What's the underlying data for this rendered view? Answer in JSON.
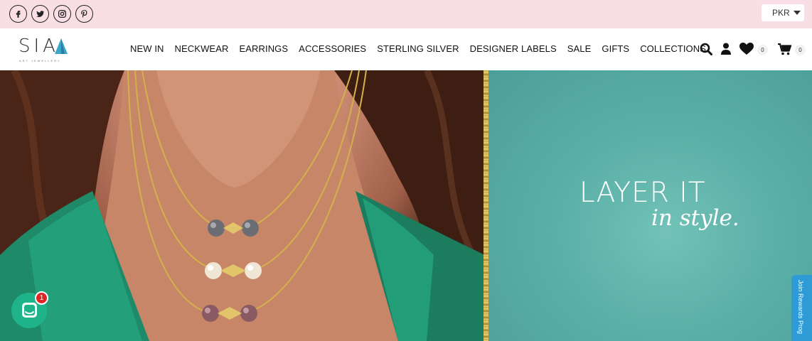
{
  "topbar": {
    "social": [
      {
        "icon": "facebook-icon"
      },
      {
        "icon": "twitter-icon"
      },
      {
        "icon": "instagram-icon"
      },
      {
        "icon": "pinterest-icon"
      }
    ],
    "currency": "PKR"
  },
  "header": {
    "logo_text": "SIA",
    "logo_tagline": "ART JEWELLERY",
    "nav": [
      "NEW IN",
      "NECKWEAR",
      "EARRINGS",
      "ACCESSORIES",
      "STERLING SILVER",
      "DESIGNER LABELS",
      "SALE",
      "GIFTS",
      "COLLECTIONS"
    ],
    "wishlist_count": "0",
    "cart_count": "0"
  },
  "hero": {
    "title": "LAYER IT",
    "subtitle": "in style.",
    "panel_color": "#5aafa6"
  },
  "rewards_tab": "Join Rewards Prog",
  "chat": {
    "badge": "1"
  },
  "colors": {
    "topbar": "#f9dfe5",
    "accent": "#1fb38a",
    "rewards": "#2e9ad6"
  }
}
